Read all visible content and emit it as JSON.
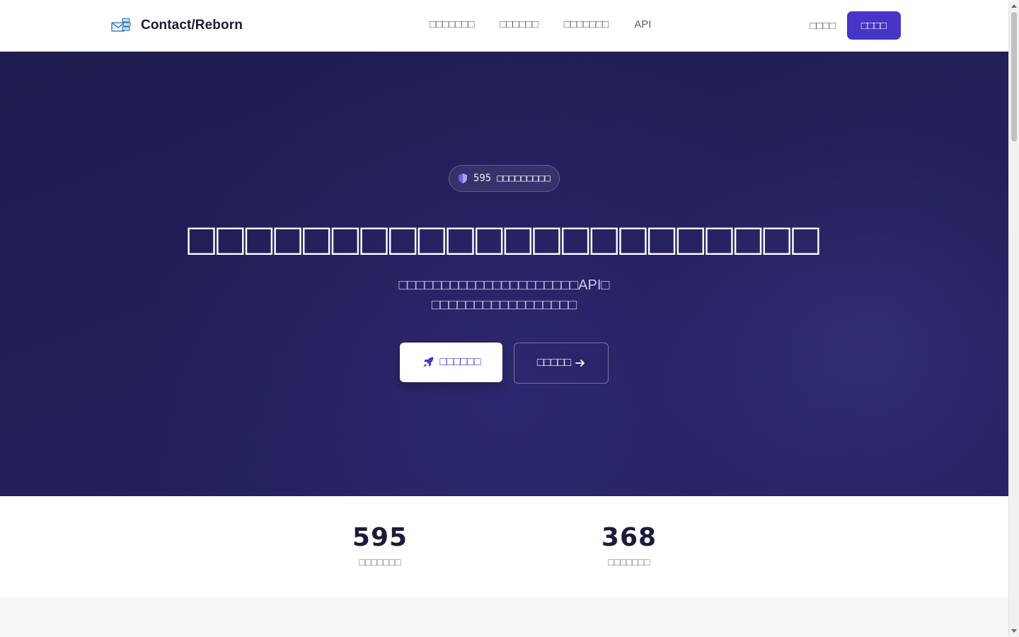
{
  "navbar": {
    "brand_name": "Contact/Reborn",
    "links": [
      "□□□□□□□",
      "□□□□□□",
      "□□□□□□□",
      "API"
    ],
    "login_label": "□□□□",
    "signup_label": "□□□□"
  },
  "hero": {
    "badge_count": "595",
    "badge_text": "□□□□□□□□□",
    "title": "□□□□□□□□□□□□□□□□□□□□□□",
    "subtitle_line1": "□□□□□□□□□□□□□□□□□□□□□API□",
    "subtitle_line2": "□□□□□□□□□□□□□□□□□",
    "primary_button_label": "□□□□□□",
    "secondary_button_label": "□□□□□"
  },
  "stats": [
    {
      "value": "595",
      "label": "□□□□□□□"
    },
    {
      "value": "368",
      "label": "□□□□□□□"
    }
  ],
  "colors": {
    "accent": "#4636c7",
    "hero_bg": "#221f5a",
    "text_dark": "#1b1b3a"
  },
  "icons": {
    "brand": "envelope-stack-icon",
    "badge": "shield-icon",
    "primary": "rocket-icon",
    "secondary": "arrow-right-icon"
  }
}
